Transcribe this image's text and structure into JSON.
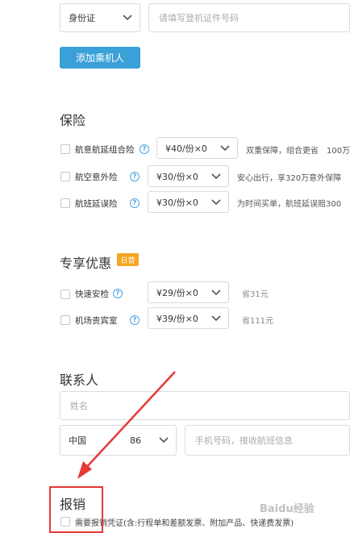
{
  "passenger": {
    "id_type": "身份证",
    "id_placeholder": "请填写登机证件号码",
    "add_button": "添加乘机人"
  },
  "insurance": {
    "title": "保险",
    "items": [
      {
        "name": "航意航延组合险",
        "price": "¥40/份×0",
        "desc": "双重保障，组合更省　100万"
      },
      {
        "name": "航空意外险",
        "price": "¥30/份×0",
        "desc": "安心出行，享320万意外保障"
      },
      {
        "name": "航班延误险",
        "price": "¥30/份×0",
        "desc": "为时间买单，航班延误赔300"
      }
    ]
  },
  "exclusive": {
    "title": "专享优惠",
    "badge": "日营",
    "items": [
      {
        "name": "快速安检",
        "price": "¥29/份×0",
        "desc": "省31元"
      },
      {
        "name": "机场贵宾室",
        "price": "¥39/份×0",
        "desc": "省111元"
      }
    ]
  },
  "contact": {
    "title": "联系人",
    "name_placeholder": "姓名",
    "country": "中国",
    "code": "86",
    "phone_placeholder": "手机号码，接收航班信息"
  },
  "reimburse": {
    "title": "报销",
    "checkbox_label": "需要报销凭证(含:行程单和差额发票、附加产品、快递费发票)"
  },
  "watermark": "Baidu经验",
  "colors": {
    "accent": "#3aa0d8",
    "badge": "#f5a623",
    "annotation": "#e53935"
  }
}
